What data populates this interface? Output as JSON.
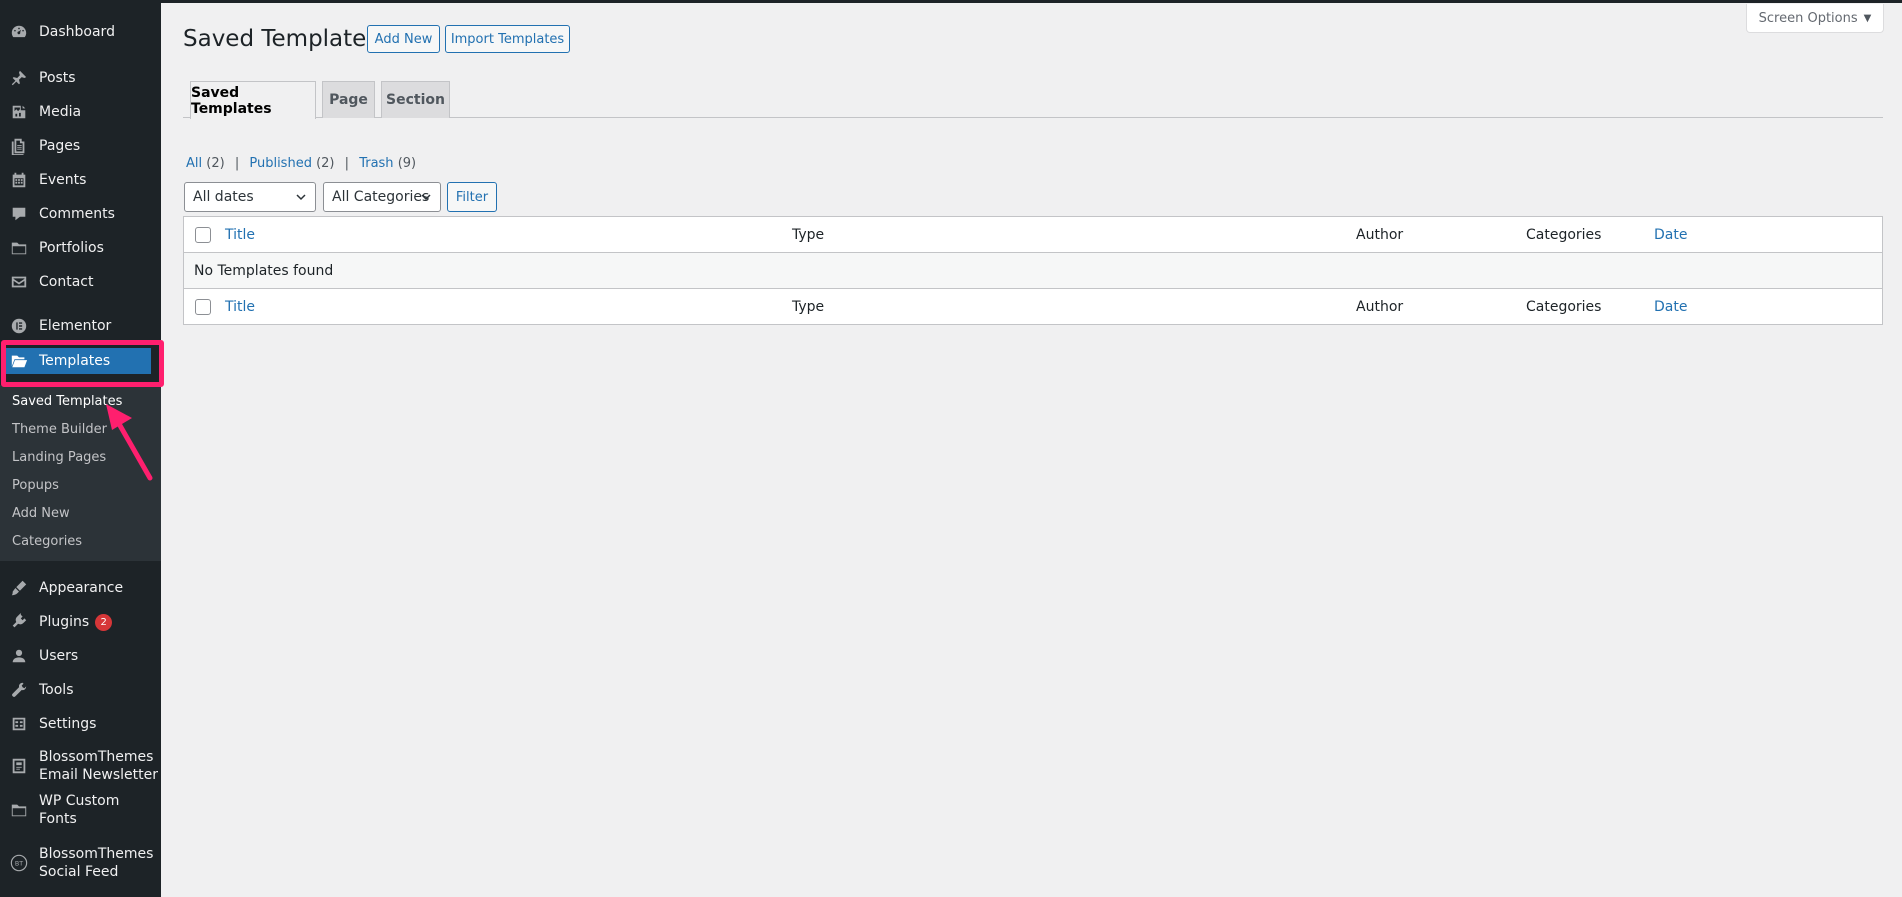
{
  "sidebar": {
    "items": [
      {
        "label": "Dashboard",
        "icon": "dashboard-icon"
      },
      {
        "label": "Posts",
        "icon": "pin-icon"
      },
      {
        "label": "Media",
        "icon": "media-icon"
      },
      {
        "label": "Pages",
        "icon": "pages-icon"
      },
      {
        "label": "Events",
        "icon": "calendar-icon"
      },
      {
        "label": "Comments",
        "icon": "comment-icon"
      },
      {
        "label": "Portfolios",
        "icon": "folder-icon"
      },
      {
        "label": "Contact",
        "icon": "mail-icon"
      },
      {
        "label": "Elementor",
        "icon": "elementor-icon"
      },
      {
        "label": "Templates",
        "icon": "folder-open-icon"
      },
      {
        "label": "Appearance",
        "icon": "brush-icon"
      },
      {
        "label": "Plugins",
        "icon": "plugin-icon",
        "badge": "2"
      },
      {
        "label": "Users",
        "icon": "user-icon"
      },
      {
        "label": "Tools",
        "icon": "wrench-icon"
      },
      {
        "label": "Settings",
        "icon": "settings-icon"
      },
      {
        "label": "BlossomThemes Email Newsletter",
        "line1": "BlossomThemes",
        "line2": "Email Newsletter",
        "icon": "newsletter-icon"
      },
      {
        "label": "WP Custom Fonts",
        "icon": "folder-icon"
      },
      {
        "label": "BlossomThemes Social Feed",
        "line1": "BlossomThemes",
        "line2": "Social Feed",
        "icon": "bt-logo-icon"
      }
    ],
    "submenu": [
      "Saved Templates",
      "Theme Builder",
      "Landing Pages",
      "Popups",
      "Add New",
      "Categories"
    ]
  },
  "header": {
    "title": "Saved Templates",
    "add_new": "Add New",
    "import": "Import Templates",
    "screen_options": "Screen Options"
  },
  "tabs": [
    "Saved Templates",
    "Page",
    "Section"
  ],
  "views": {
    "all_label": "All",
    "all_count": "(2)",
    "published_label": "Published",
    "published_count": "(2)",
    "trash_label": "Trash",
    "trash_count": "(9)"
  },
  "filters": {
    "dates": "All dates",
    "categories": "All Categories",
    "filter_button": "Filter"
  },
  "table": {
    "columns": [
      "Title",
      "Type",
      "Author",
      "Categories",
      "Date"
    ],
    "empty_message": "No Templates found"
  },
  "colors": {
    "accent": "#2271b1",
    "annotation": "#ff1f6e"
  }
}
